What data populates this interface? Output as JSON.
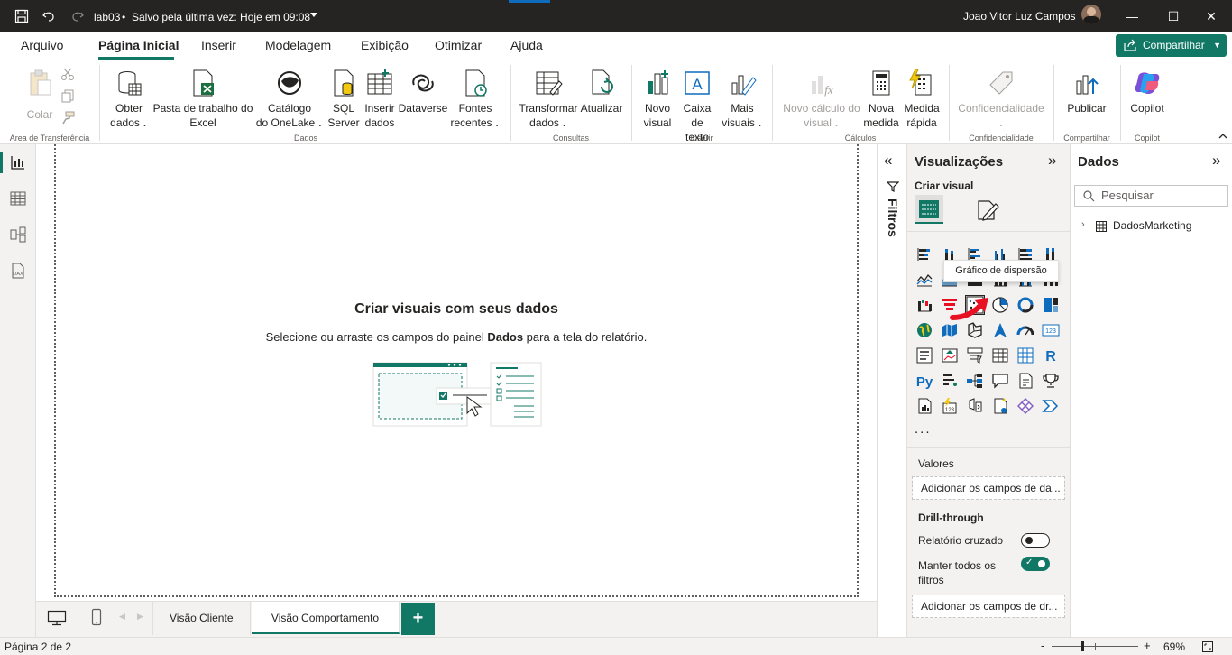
{
  "titlebar": {
    "filename": "lab03",
    "save_status": "Salvo pela última vez: Hoje em 09:08",
    "user_name": "Joao Vitor Luz Campos"
  },
  "menu": {
    "tabs": [
      "Arquivo",
      "Página Inicial",
      "Inserir",
      "Modelagem",
      "Exibição",
      "Otimizar",
      "Ajuda"
    ],
    "active_tab": "Página Inicial",
    "share_label": "Compartilhar"
  },
  "ribbon": {
    "clipboard": {
      "paste": "Colar",
      "group": "Área de Transferência"
    },
    "data": {
      "get_data": [
        "Obter",
        "dados"
      ],
      "excel": [
        "Pasta de trabalho do",
        "Excel"
      ],
      "onelake": [
        "Catálogo",
        "do OneLake"
      ],
      "sql": [
        "SQL",
        "Server"
      ],
      "enter_data": [
        "Inserir",
        "dados"
      ],
      "dataverse": "Dataverse",
      "recent": [
        "Fontes",
        "recentes"
      ],
      "group": "Dados"
    },
    "queries": {
      "transform": [
        "Transformar",
        "dados"
      ],
      "refresh": "Atualizar",
      "group": "Consultas"
    },
    "insert": {
      "new_visual": [
        "Novo",
        "visual"
      ],
      "text_box": [
        "Caixa de",
        "texto"
      ],
      "more_visuals": [
        "Mais",
        "visuais"
      ],
      "group": "Inserir"
    },
    "calc": {
      "new_visual_calc": [
        "Novo cálculo do",
        "visual"
      ],
      "new_measure": [
        "Nova",
        "medida"
      ],
      "quick_measure": [
        "Medida",
        "rápida"
      ],
      "group": "Cálculos"
    },
    "sensitivity": {
      "label": "Confidencialidade",
      "group": "Confidencialidade"
    },
    "share": {
      "publish": "Publicar",
      "group": "Compartilhar"
    },
    "copilot": {
      "label": "Copilot",
      "group": "Copilot"
    }
  },
  "canvas": {
    "heading": "Criar visuais com seus dados",
    "sub_before": "Selecione ou arraste os campos do painel ",
    "sub_bold": "Dados",
    "sub_after": " para a tela do relatório."
  },
  "pages": {
    "tabs": [
      "Visão Cliente",
      "Visão Comportamento"
    ],
    "active": "Visão Comportamento",
    "add": "+"
  },
  "status": {
    "page_indicator": "Página 2 de 2",
    "zoom": "69%",
    "zoom_minus": "-",
    "zoom_plus": "+"
  },
  "filters": {
    "label": "Filtros"
  },
  "visualizations": {
    "title": "Visualizações",
    "build_visual": "Criar visual",
    "tooltip": "Gráfico de dispersão",
    "more": "...",
    "values_label": "Valores",
    "values_well": "Adicionar os campos de da...",
    "drill_title": "Drill-through",
    "cross_report": "Relatório cruzado",
    "cross_report_on": false,
    "keep_filters": [
      "Manter todos os",
      "filtros"
    ],
    "keep_filters_on": true,
    "drill_well": "Adicionar os campos de dr..."
  },
  "data_pane": {
    "title": "Dados",
    "search_placeholder": "Pesquisar",
    "tables": [
      "DadosMarketing"
    ]
  },
  "colors": {
    "accent": "#117865",
    "titlebar": "#252423",
    "arrow": "#e81123"
  }
}
